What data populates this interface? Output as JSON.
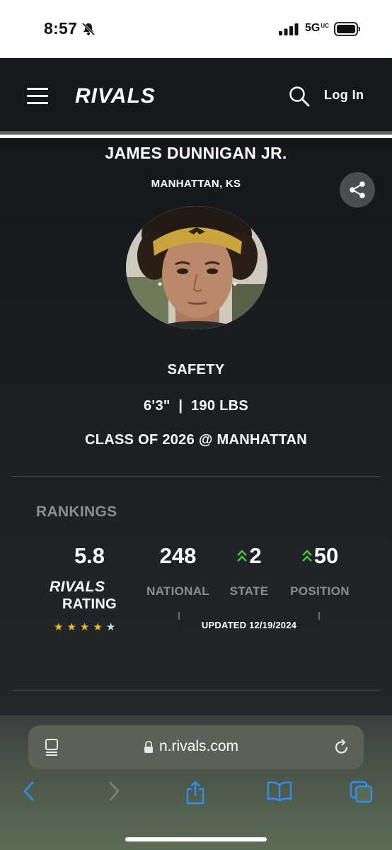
{
  "status_bar": {
    "time": "8:57",
    "network": "5G",
    "network_sub": "UC",
    "icons": [
      "bell-slash-icon",
      "signal-icon",
      "battery-icon"
    ]
  },
  "header": {
    "brand": "RIVALS",
    "login_label": "Log In",
    "icons": [
      "menu-icon",
      "search-icon"
    ]
  },
  "player": {
    "name": "JAMES DUNNIGAN JR.",
    "hometown": "MANHATTAN, KS",
    "position": "SAFETY",
    "height": "6'3\"",
    "separator": "|",
    "weight": "190 LBS",
    "class_line": "CLASS OF 2026 @ MANHATTAN"
  },
  "rankings": {
    "heading": "RANKINGS",
    "rating": {
      "value": "5.8",
      "brand": "RIVALS",
      "label": "RATING",
      "stars_filled": 4,
      "stars_total": 5
    },
    "national": {
      "value": "248",
      "label": "NATIONAL"
    },
    "state": {
      "value": "2",
      "label": "STATE",
      "trend": "up"
    },
    "position": {
      "value": "50",
      "label": "POSITION",
      "trend": "up"
    },
    "updated": "UPDATED 12/19/2024"
  },
  "colors": {
    "header_bg": "#16191c",
    "accent_strip": "#5d6456",
    "star_gold": "#f1b81a",
    "trend_green": "#4cc43b",
    "muted_label": "#8a8e91"
  },
  "browser": {
    "url": "n.rivals.com",
    "icons": [
      "reader-icon",
      "lock-icon",
      "reload-icon",
      "back-icon",
      "forward-icon",
      "share-icon",
      "bookmarks-icon",
      "tabs-icon"
    ]
  }
}
